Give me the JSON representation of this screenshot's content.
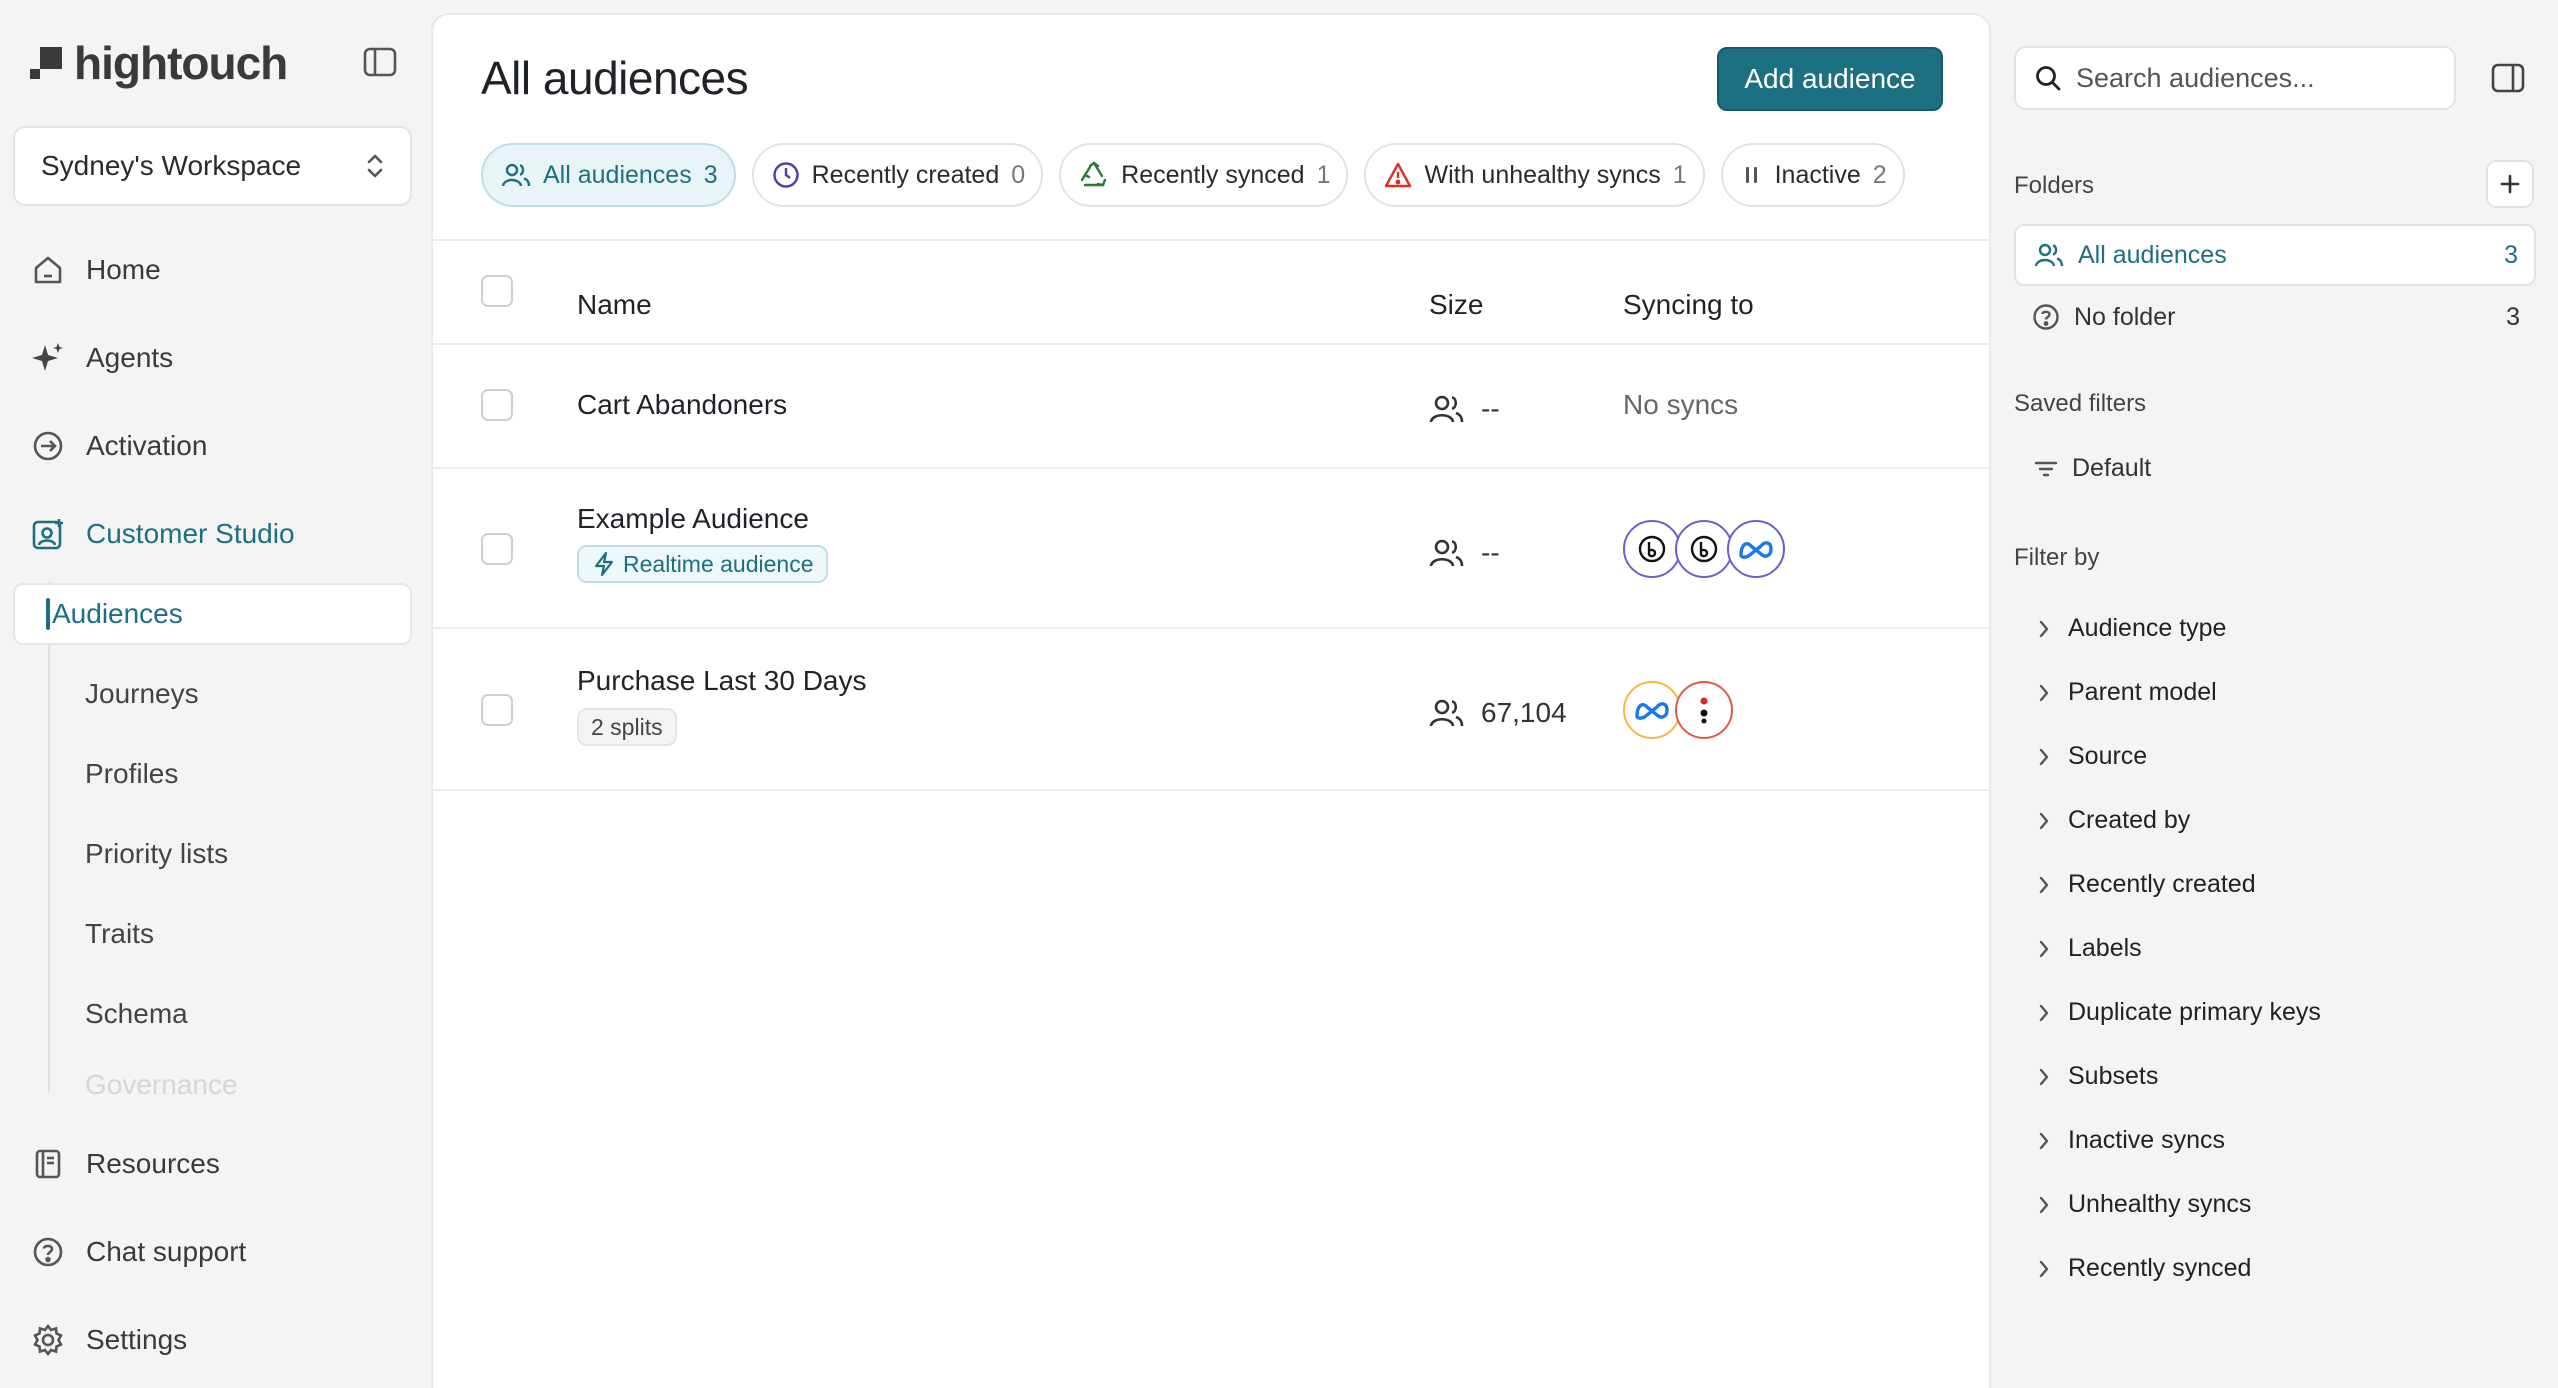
{
  "brand": {
    "name": "hightouch"
  },
  "workspace": {
    "name": "Sydney's Workspace"
  },
  "nav": {
    "main": [
      {
        "label": "Home",
        "icon": "home-icon"
      },
      {
        "label": "Agents",
        "icon": "sparkle-icon"
      },
      {
        "label": "Activation",
        "icon": "activation-icon"
      },
      {
        "label": "Customer Studio",
        "icon": "customer-studio-icon"
      }
    ],
    "sub": [
      "Audiences",
      "Journeys",
      "Profiles",
      "Priority lists",
      "Traits",
      "Schema",
      "Governance"
    ],
    "bottom": [
      {
        "label": "Resources",
        "icon": "book-icon"
      },
      {
        "label": "Chat support",
        "icon": "question-icon"
      },
      {
        "label": "Settings",
        "icon": "gear-icon"
      }
    ]
  },
  "main": {
    "title": "All audiences",
    "add_button": "Add audience",
    "chips": [
      {
        "label": "All audiences",
        "count": "3"
      },
      {
        "label": "Recently created",
        "count": "0"
      },
      {
        "label": "Recently synced",
        "count": "1"
      },
      {
        "label": "With unhealthy syncs",
        "count": "1"
      },
      {
        "label": "Inactive",
        "count": "2"
      }
    ],
    "columns": {
      "name": "Name",
      "size": "Size",
      "syncing": "Syncing to"
    },
    "rows": [
      {
        "name": "Cart Abandoners",
        "size": "--",
        "syncing_text": "No syncs"
      },
      {
        "name": "Example Audience",
        "badge": "Realtime audience",
        "size": "--"
      },
      {
        "name": "Purchase Last 30 Days",
        "badge": "2 splits",
        "size": "67,104"
      }
    ]
  },
  "right": {
    "search_placeholder": "Search audiences...",
    "folders_title": "Folders",
    "folders": [
      {
        "label": "All audiences",
        "count": "3"
      },
      {
        "label": "No folder",
        "count": "3"
      }
    ],
    "saved_filters_title": "Saved filters",
    "saved_filters": [
      "Default"
    ],
    "filter_by_title": "Filter by",
    "filters": [
      "Audience type",
      "Parent model",
      "Source",
      "Created by",
      "Recently created",
      "Labels",
      "Duplicate primary keys",
      "Subsets",
      "Inactive syncs",
      "Unhealthy syncs",
      "Recently synced"
    ]
  },
  "colors": {
    "accent": "#1d6f82",
    "meta": "#1877f2",
    "warning": "#d93025"
  }
}
